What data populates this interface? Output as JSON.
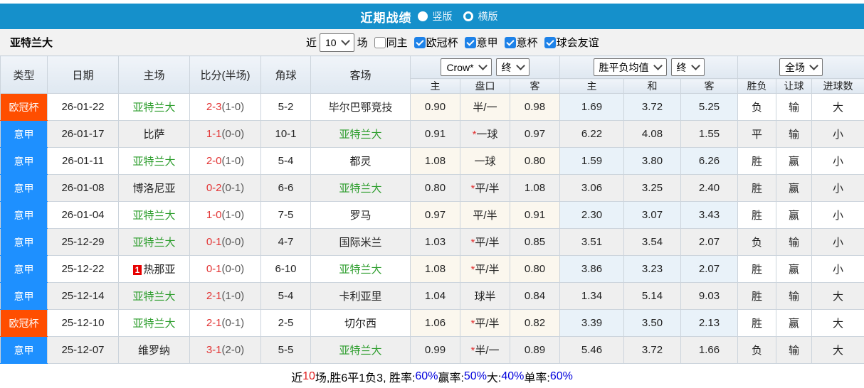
{
  "title_bar": {
    "title": "近期战绩",
    "radios": [
      {
        "label": "竖版",
        "selected": true
      },
      {
        "label": "横版",
        "selected": false
      }
    ]
  },
  "filter_bar": {
    "team": "亚特兰大",
    "near_label": "近",
    "games_select": "10",
    "games_suffix": "场",
    "checkboxes": [
      {
        "label": "同主",
        "checked": false
      },
      {
        "label": "欧冠杯",
        "checked": true
      },
      {
        "label": "意甲",
        "checked": true
      },
      {
        "label": "意杯",
        "checked": true
      },
      {
        "label": "球会友谊",
        "checked": true
      }
    ]
  },
  "table": {
    "left_headers": [
      "类型",
      "日期",
      "主场",
      "比分(半场)",
      "角球",
      "客场"
    ],
    "odds_group": {
      "select1": "Crow*",
      "select2": "终",
      "cols": [
        "主",
        "盘口",
        "客"
      ]
    },
    "avg_group": {
      "select1": "胜平负均值",
      "select2": "终",
      "cols": [
        "主",
        "和",
        "客"
      ]
    },
    "result_group": {
      "select1": "全场",
      "cols": [
        "胜负",
        "让球",
        "进球数"
      ]
    },
    "rows": [
      {
        "type": "欧冠杯",
        "type_key": "cup",
        "date": "26-01-22",
        "home": "亚特兰大",
        "home_green": true,
        "home_badge": "",
        "score": "2-3",
        "half": "(1-0)",
        "corner": "5-2",
        "away": "毕尔巴鄂竞技",
        "away_green": false,
        "odds_home": "0.90",
        "handicap": "半/一",
        "handicap_star": false,
        "odds_away": "0.98",
        "avg_home": "1.69",
        "avg_draw": "3.72",
        "avg_away": "5.25",
        "wdl": "负",
        "wdl_color": "green",
        "let_result": "输",
        "let_color": "green",
        "goal_result": "大",
        "goal_color": "red"
      },
      {
        "type": "意甲",
        "type_key": "league",
        "date": "26-01-17",
        "home": "比萨",
        "home_green": false,
        "home_badge": "",
        "score": "1-1",
        "half": "(0-0)",
        "corner": "10-1",
        "away": "亚特兰大",
        "away_green": true,
        "odds_home": "0.91",
        "handicap": "一球",
        "handicap_star": true,
        "odds_away": "0.97",
        "avg_home": "6.22",
        "avg_draw": "4.08",
        "avg_away": "1.55",
        "wdl": "平",
        "wdl_color": "blue",
        "let_result": "输",
        "let_color": "green",
        "goal_result": "小",
        "goal_color": "green"
      },
      {
        "type": "意甲",
        "type_key": "league",
        "date": "26-01-11",
        "home": "亚特兰大",
        "home_green": true,
        "home_badge": "",
        "score": "2-0",
        "half": "(1-0)",
        "corner": "5-4",
        "away": "都灵",
        "away_green": false,
        "odds_home": "1.08",
        "handicap": "一球",
        "handicap_star": false,
        "odds_away": "0.80",
        "avg_home": "1.59",
        "avg_draw": "3.80",
        "avg_away": "6.26",
        "wdl": "胜",
        "wdl_color": "red",
        "let_result": "赢",
        "let_color": "red",
        "goal_result": "小",
        "goal_color": "green"
      },
      {
        "type": "意甲",
        "type_key": "league",
        "date": "26-01-08",
        "home": "博洛尼亚",
        "home_green": false,
        "home_badge": "",
        "score": "0-2",
        "half": "(0-1)",
        "corner": "6-6",
        "away": "亚特兰大",
        "away_green": true,
        "odds_home": "0.80",
        "handicap": "平/半",
        "handicap_star": true,
        "odds_away": "1.08",
        "avg_home": "3.06",
        "avg_draw": "3.25",
        "avg_away": "2.40",
        "wdl": "胜",
        "wdl_color": "red",
        "let_result": "赢",
        "let_color": "red",
        "goal_result": "小",
        "goal_color": "green"
      },
      {
        "type": "意甲",
        "type_key": "league",
        "date": "26-01-04",
        "home": "亚特兰大",
        "home_green": true,
        "home_badge": "",
        "score": "1-0",
        "half": "(1-0)",
        "corner": "7-5",
        "away": "罗马",
        "away_green": false,
        "odds_home": "0.97",
        "handicap": "平/半",
        "handicap_star": false,
        "odds_away": "0.91",
        "avg_home": "2.30",
        "avg_draw": "3.07",
        "avg_away": "3.43",
        "wdl": "胜",
        "wdl_color": "red",
        "let_result": "赢",
        "let_color": "red",
        "goal_result": "小",
        "goal_color": "green"
      },
      {
        "type": "意甲",
        "type_key": "league",
        "date": "25-12-29",
        "home": "亚特兰大",
        "home_green": true,
        "home_badge": "",
        "score": "0-1",
        "half": "(0-0)",
        "corner": "4-7",
        "away": "国际米兰",
        "away_green": false,
        "odds_home": "1.03",
        "handicap": "平/半",
        "handicap_star": true,
        "odds_away": "0.85",
        "avg_home": "3.51",
        "avg_draw": "3.54",
        "avg_away": "2.07",
        "wdl": "负",
        "wdl_color": "green",
        "let_result": "输",
        "let_color": "green",
        "goal_result": "小",
        "goal_color": "green"
      },
      {
        "type": "意甲",
        "type_key": "league",
        "date": "25-12-22",
        "home": "热那亚",
        "home_green": false,
        "home_badge": "1",
        "score": "0-1",
        "half": "(0-0)",
        "corner": "6-10",
        "away": "亚特兰大",
        "away_green": true,
        "odds_home": "1.08",
        "handicap": "平/半",
        "handicap_star": true,
        "odds_away": "0.80",
        "avg_home": "3.86",
        "avg_draw": "3.23",
        "avg_away": "2.07",
        "wdl": "胜",
        "wdl_color": "red",
        "let_result": "赢",
        "let_color": "red",
        "goal_result": "小",
        "goal_color": "green"
      },
      {
        "type": "意甲",
        "type_key": "league",
        "date": "25-12-14",
        "home": "亚特兰大",
        "home_green": true,
        "home_badge": "",
        "score": "2-1",
        "half": "(1-0)",
        "corner": "5-4",
        "away": "卡利亚里",
        "away_green": false,
        "odds_home": "1.04",
        "handicap": "球半",
        "handicap_star": false,
        "odds_away": "0.84",
        "avg_home": "1.34",
        "avg_draw": "5.14",
        "avg_away": "9.03",
        "wdl": "胜",
        "wdl_color": "red",
        "let_result": "输",
        "let_color": "green",
        "goal_result": "大",
        "goal_color": "red"
      },
      {
        "type": "欧冠杯",
        "type_key": "cup",
        "date": "25-12-10",
        "home": "亚特兰大",
        "home_green": true,
        "home_badge": "",
        "score": "2-1",
        "half": "(0-1)",
        "corner": "2-5",
        "away": "切尔西",
        "away_green": false,
        "odds_home": "1.06",
        "handicap": "平/半",
        "handicap_star": true,
        "odds_away": "0.82",
        "avg_home": "3.39",
        "avg_draw": "3.50",
        "avg_away": "2.13",
        "wdl": "胜",
        "wdl_color": "red",
        "let_result": "赢",
        "let_color": "red",
        "goal_result": "大",
        "goal_color": "red"
      },
      {
        "type": "意甲",
        "type_key": "league",
        "date": "25-12-07",
        "home": "维罗纳",
        "home_green": false,
        "home_badge": "",
        "score": "3-1",
        "half": "(2-0)",
        "corner": "5-5",
        "away": "亚特兰大",
        "away_green": true,
        "odds_home": "0.99",
        "handicap": "半/一",
        "handicap_star": true,
        "odds_away": "0.89",
        "avg_home": "5.46",
        "avg_draw": "3.72",
        "avg_away": "1.66",
        "wdl": "负",
        "wdl_color": "green",
        "let_result": "输",
        "let_color": "green",
        "goal_result": "大",
        "goal_color": "red"
      }
    ]
  },
  "summary": {
    "segments": [
      {
        "text": "近",
        "color": "black"
      },
      {
        "text": "10",
        "color": "red"
      },
      {
        "text": "场,胜6平1负3, 胜率:",
        "color": "black"
      },
      {
        "text": "60%",
        "color": "blue"
      },
      {
        "text": " 赢率:",
        "color": "black"
      },
      {
        "text": "50%",
        "color": "blue"
      },
      {
        "text": " 大:",
        "color": "black"
      },
      {
        "text": "40%",
        "color": "blue"
      },
      {
        "text": " 单率:",
        "color": "black"
      },
      {
        "text": "60%",
        "color": "blue"
      }
    ]
  },
  "colors": {
    "top_bar": "#1590cb",
    "cup_badge": "#ff4e00",
    "league_badge": "#1e90ff",
    "team_green": "#2e9e2e",
    "score_red": "#e23333",
    "win_red": "#cf2525",
    "loss_green": "#2c9a2c",
    "draw_blue": "#2626cc",
    "percent_blue": "#0000dd",
    "odds_col_bg": "#fbf7ee",
    "avg_col_bg": "#e9f2f9"
  }
}
